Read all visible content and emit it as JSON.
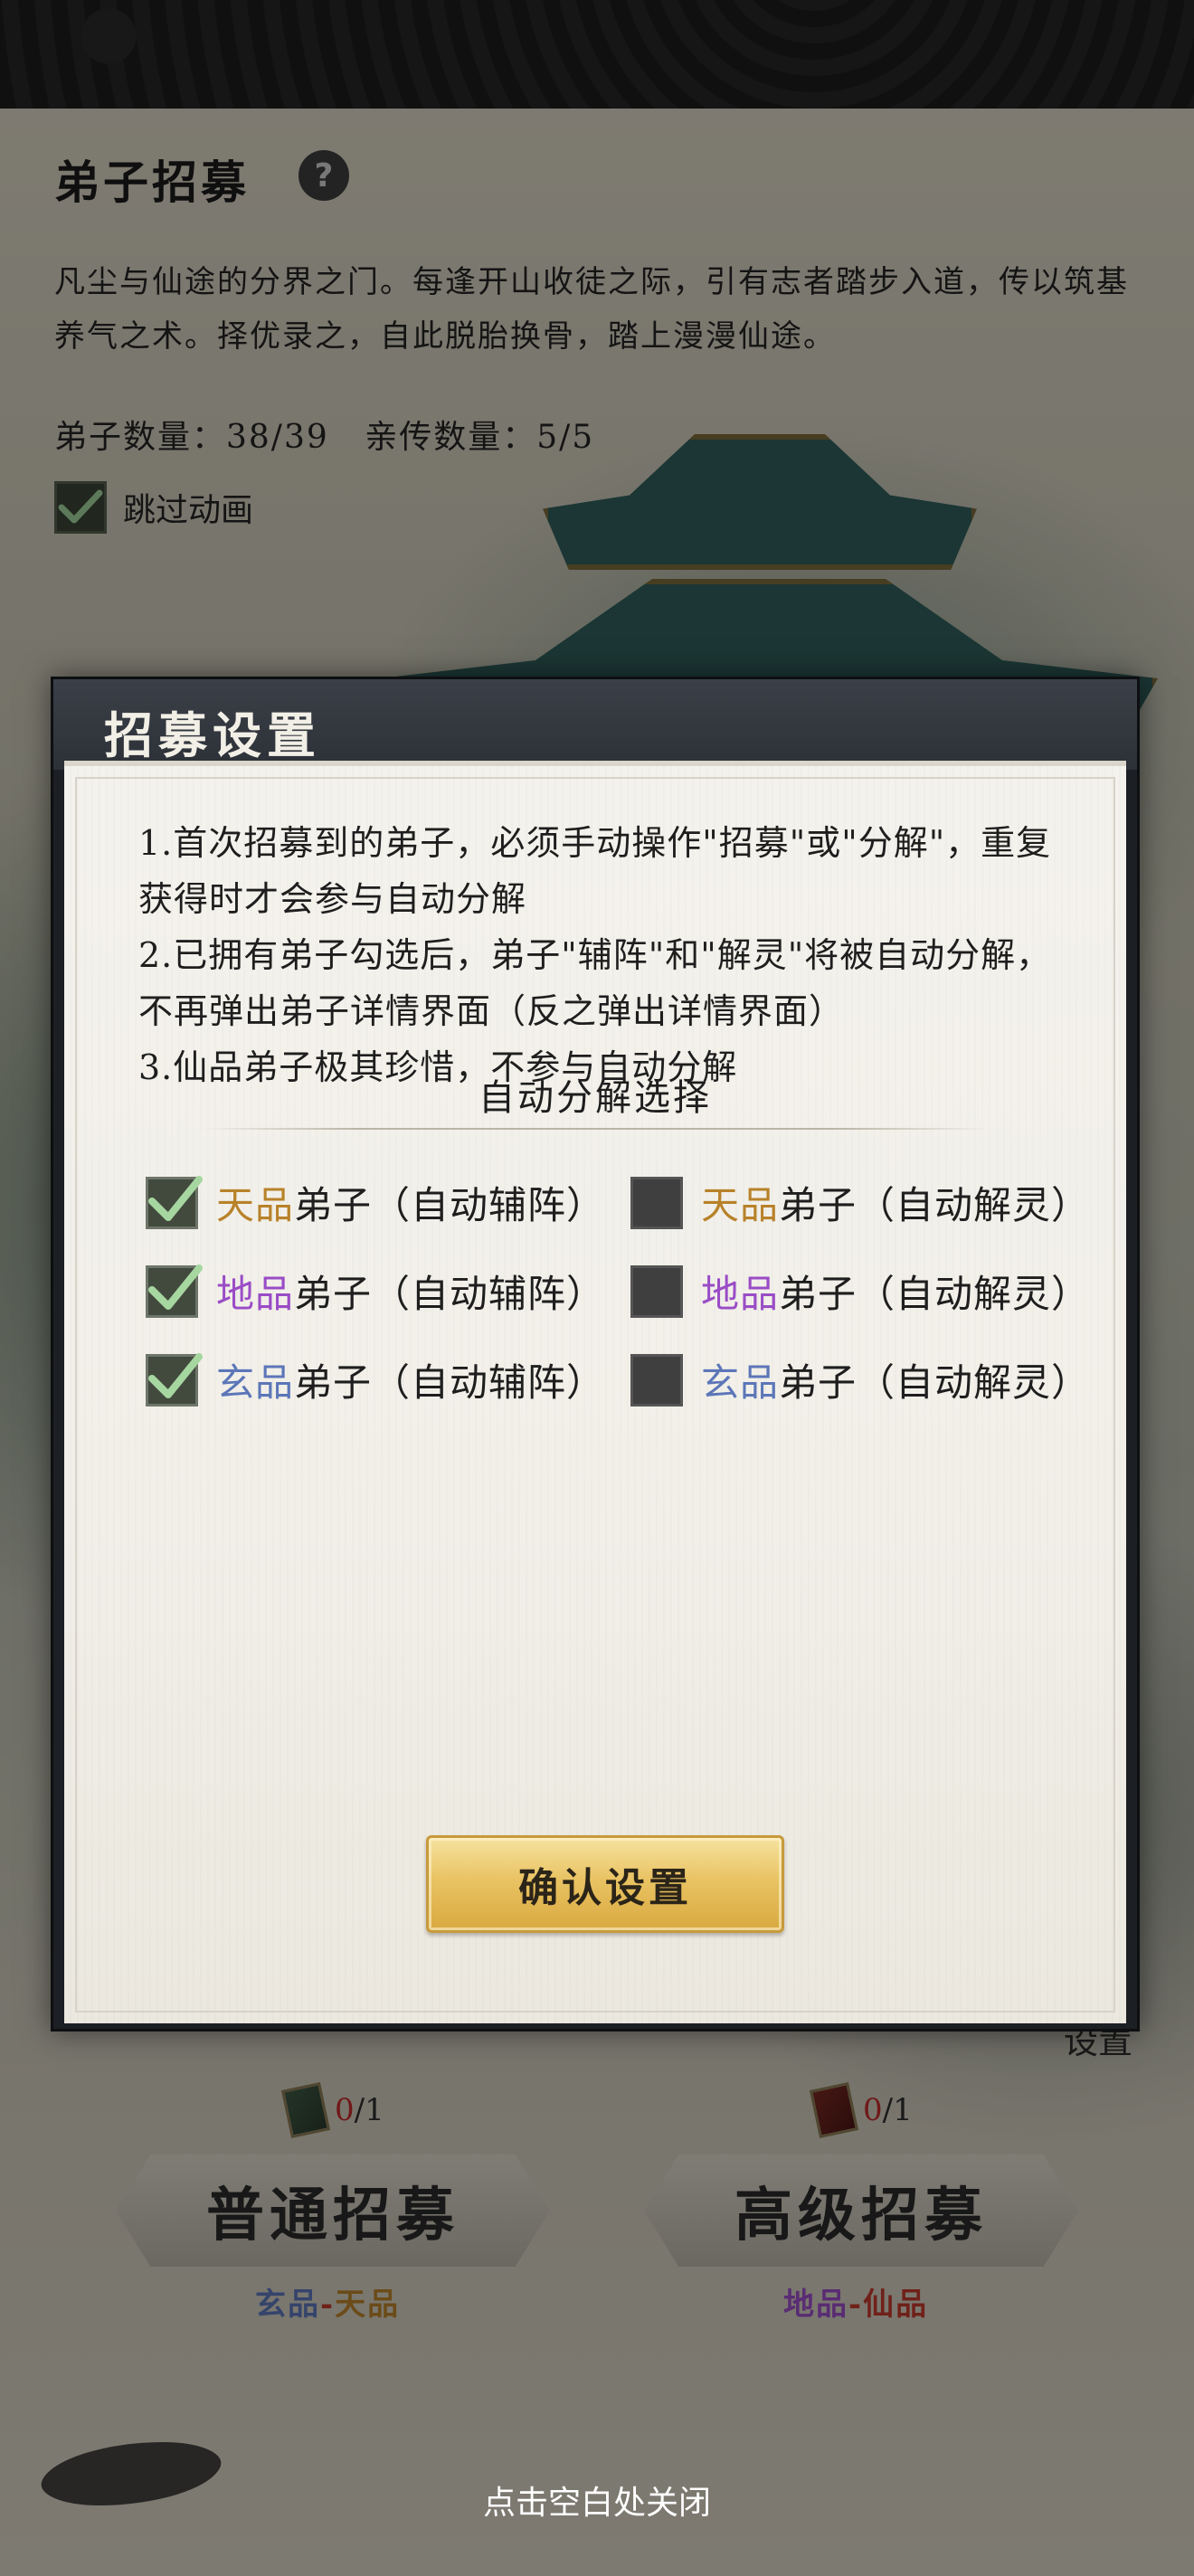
{
  "page": {
    "title": "弟子招募",
    "help_icon": "?",
    "description": "凡尘与仙途的分界之门。每逢开山收徒之际，引有志者踏步入道，传以筑基养气之术。择优录之，自此脱胎换骨，踏上漫漫仙途。",
    "disciple_count": "弟子数量：38/39",
    "inner_disciple_count": "亲传数量：5/5",
    "skip_animation": {
      "label": "跳过动画",
      "checked": true
    },
    "settings_text": "设置",
    "normal": {
      "ticket_have": "0",
      "ticket_total": "/1",
      "button": "普通招募",
      "range_low": "玄品",
      "range_sep": "-",
      "range_high": "天品"
    },
    "advanced": {
      "ticket_have": "0",
      "ticket_total": "/1",
      "button": "高级招募",
      "range_low": "地品",
      "range_sep": "-",
      "range_high": "仙品"
    },
    "close_hint": "点击空白处关闭"
  },
  "modal": {
    "title": "招募设置",
    "rules": [
      "1.首次招募到的弟子，必须手动操作\"招募\"或\"分解\"，重复获得时才会参与自动分解",
      "2.已拥有弟子勾选后，弟子\"辅阵\"和\"解灵\"将被自动分解，不再弹出弟子详情界面（反之弹出详情界面）",
      "3.仙品弟子极其珍惜，不参与自动分解"
    ],
    "section_title": "自动分解选择",
    "options": [
      {
        "grade": "天品",
        "text": "弟子（自动辅阵）",
        "checked": true
      },
      {
        "grade": "天品",
        "text": "弟子（自动解灵）",
        "checked": false
      },
      {
        "grade": "地品",
        "text": "弟子（自动辅阵）",
        "checked": true
      },
      {
        "grade": "地品",
        "text": "弟子（自动解灵）",
        "checked": false
      },
      {
        "grade": "玄品",
        "text": "弟子（自动辅阵）",
        "checked": true
      },
      {
        "grade": "玄品",
        "text": "弟子（自动解灵）",
        "checked": false
      }
    ],
    "confirm_button": "确认设置"
  },
  "colors": {
    "tian_grade": "#b8822a",
    "di_grade": "#9a4cc6",
    "xuan_grade": "#5c76b8",
    "xian_grade": "#c0392b",
    "confirm_gold": "#e9c363"
  }
}
